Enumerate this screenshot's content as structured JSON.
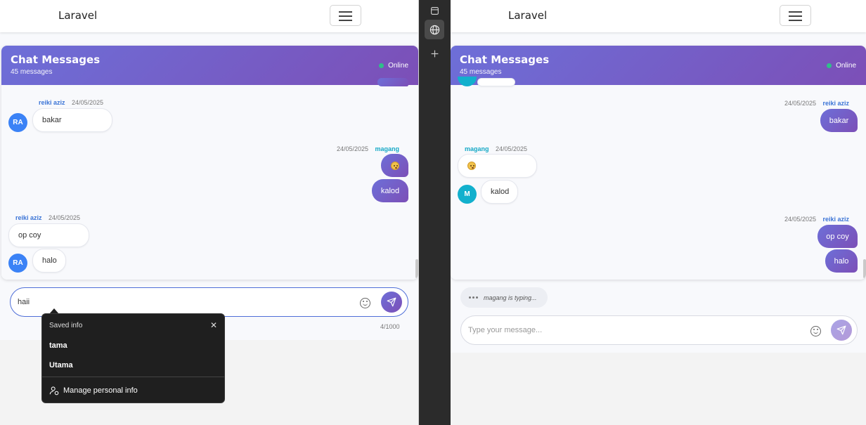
{
  "left": {
    "brand": "Laravel",
    "chat": {
      "title": "Chat Messages",
      "count_label": "45 messages",
      "status": "Online"
    },
    "messages": [
      {
        "sender": "reiki aziz",
        "date": "24/05/2025",
        "text": "bakar",
        "initials": "RA",
        "direction": "incoming"
      },
      {
        "sender": "magang",
        "date": "24/05/2025",
        "text": "kalod",
        "direction": "outgoing"
      },
      {
        "sender": "reiki aziz",
        "date": "24/05/2025",
        "text": "op coy",
        "direction": "incoming"
      },
      {
        "sender": "reiki aziz",
        "date": "",
        "text": "halo",
        "initials": "RA",
        "direction": "incoming"
      }
    ],
    "composer": {
      "value": "haii",
      "char_count": "4/1000"
    },
    "autofill": {
      "title": "Saved info",
      "items": [
        "tama",
        "Utama"
      ],
      "manage": "Manage personal info"
    }
  },
  "right": {
    "brand": "Laravel",
    "chat": {
      "title": "Chat Messages",
      "count_label": "45 messages",
      "status": "Online"
    },
    "messages": [
      {
        "sender": "reiki aziz",
        "date": "24/05/2025",
        "text": "bakar",
        "direction": "outgoing"
      },
      {
        "sender": "magang",
        "date": "24/05/2025",
        "text": "kalod",
        "initials": "M",
        "direction": "incoming"
      },
      {
        "sender": "reiki aziz",
        "date": "24/05/2025",
        "text": "op coy",
        "direction": "outgoing"
      },
      {
        "sender": "reiki aziz",
        "date": "",
        "text": "halo",
        "direction": "outgoing"
      }
    ],
    "typing": "magang is typing...",
    "composer": {
      "placeholder": "Type your message..."
    }
  },
  "colors": {
    "accent_start": "#6d6fd8",
    "accent_end": "#7c4fb7",
    "online": "#2fbf8a",
    "focus_border": "#4f6fd8"
  },
  "icons": [
    "menu-icon",
    "emoji-icon",
    "send-icon",
    "close-icon",
    "manage-person-icon",
    "tab-sidebar-icon",
    "globe-icon",
    "plus-icon"
  ]
}
